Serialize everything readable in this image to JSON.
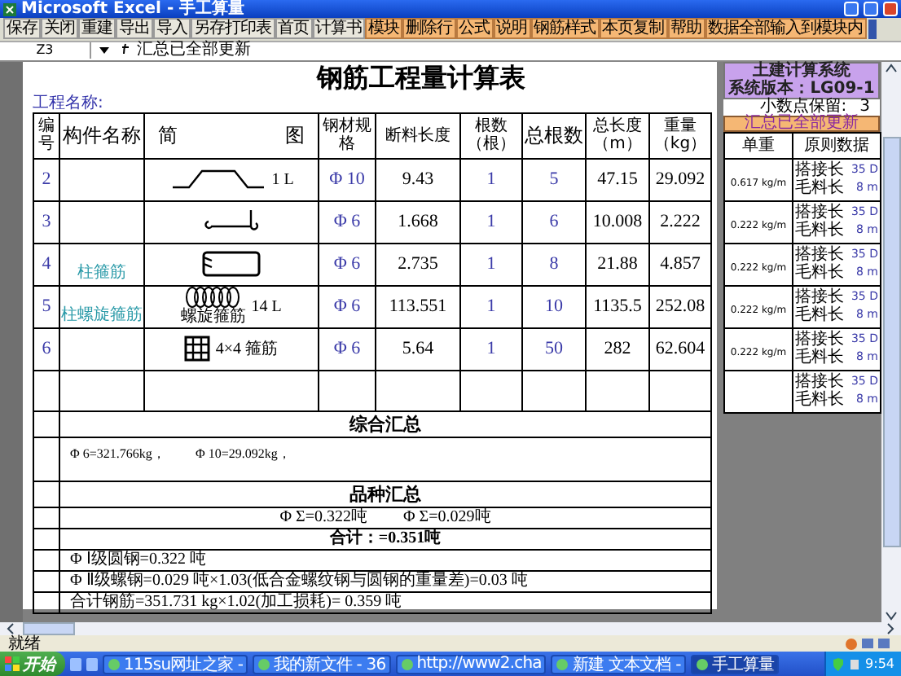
{
  "window": {
    "title": "Microsoft Excel - 手工算量"
  },
  "toolbar": [
    {
      "label": "保存",
      "kind": "plain"
    },
    {
      "label": "关闭",
      "kind": "plain"
    },
    {
      "label": "重建",
      "kind": "plain"
    },
    {
      "label": "导出",
      "kind": "plain"
    },
    {
      "label": "导入",
      "kind": "plain"
    },
    {
      "label": "另存打印表",
      "kind": "plain"
    },
    {
      "label": "首页",
      "kind": "plain"
    },
    {
      "label": "计算书",
      "kind": "plain"
    },
    {
      "label": "模块",
      "kind": "accent"
    },
    {
      "label": "删除行",
      "kind": "accent"
    },
    {
      "label": "公式",
      "kind": "accent"
    },
    {
      "label": "说明",
      "kind": "accent"
    },
    {
      "label": "钢筋样式",
      "kind": "accent"
    },
    {
      "label": "本页复制",
      "kind": "accent"
    },
    {
      "label": "帮助",
      "kind": "accent"
    },
    {
      "label": "数据全部输入到模块内",
      "kind": "accent"
    }
  ],
  "formula_bar": {
    "cell": "Z3",
    "content": "汇总已全部更新"
  },
  "sheet": {
    "title": "钢筋工程量计算表",
    "project_label": "工程名称:",
    "columns": [
      "编号",
      "构件名称",
      "简",
      "图",
      "钢材规格",
      "断料长度",
      "根数（根）",
      "总根数",
      "总长度（m）",
      "重量（kg）"
    ],
    "rows": [
      {
        "no": "2",
        "name": "",
        "kind": "bent",
        "shape_note": "1 L",
        "spec": "Φ 10",
        "cut_length": "9.43",
        "count": "1",
        "total_count": "5",
        "total_length": "47.15",
        "weight": "29.092"
      },
      {
        "no": "3",
        "name": "",
        "kind": "hook",
        "shape_note": "",
        "spec": "Φ 6",
        "cut_length": "1.668",
        "count": "1",
        "total_count": "6",
        "total_length": "10.008",
        "weight": "2.222"
      },
      {
        "no": "4",
        "name": "柱箍筋",
        "kind": "stirrup",
        "shape_note": "",
        "spec": "Φ 6",
        "cut_length": "2.735",
        "count": "1",
        "total_count": "8",
        "total_length": "21.88",
        "weight": "4.857"
      },
      {
        "no": "5",
        "name": "柱螺旋箍筋",
        "kind": "spiral",
        "shape_caption": "螺旋箍筋",
        "shape_note": "14 L",
        "spec": "Φ 6",
        "cut_length": "113.551",
        "count": "1",
        "total_count": "10",
        "total_length": "1135.5",
        "weight": "252.08"
      },
      {
        "no": "6",
        "name": "",
        "kind": "grid",
        "shape_note": "4×4 箍筋",
        "spec": "Φ 6",
        "cut_length": "5.64",
        "count": "1",
        "total_count": "50",
        "total_length": "282",
        "weight": "62.604"
      }
    ],
    "summary": {
      "title": "综合汇总",
      "items": [
        "Φ 6=321.766kg，",
        "Φ 10=29.092kg，"
      ]
    },
    "variety": {
      "title": "品种汇总",
      "items": [
        "Φ Σ=0.322吨",
        "Φ Σ=0.029吨"
      ]
    },
    "total": "合计：=0.351吨",
    "notes": [
      "Φ Ⅰ级圆钢=0.322 吨",
      "Φ Ⅱ级螺钢=0.029 吨×1.03(低合金螺纹钢与圆钢的重量差)=0.03 吨",
      "合计钢筋=351.731 kg×1.02(加工损耗)= 0.359 吨"
    ]
  },
  "side_panel": {
    "title": "土建计算系统",
    "version": "系统版本：LG09-1",
    "decimals_label": "小数点保留:",
    "decimals": "3",
    "update_button": "汇总已全部更新",
    "columns": [
      "单重",
      "原则数据"
    ],
    "rows": [
      {
        "unit_weight": "0.617 kg/m",
        "lap_label": "搭接长",
        "lap": "35 D",
        "stock_label": "毛料长",
        "stock": "8 m"
      },
      {
        "unit_weight": "0.222 kg/m",
        "lap_label": "搭接长",
        "lap": "35 D",
        "stock_label": "毛料长",
        "stock": "8 m"
      },
      {
        "unit_weight": "0.222 kg/m",
        "lap_label": "搭接长",
        "lap": "35 D",
        "stock_label": "毛料长",
        "stock": "8 m"
      },
      {
        "unit_weight": "0.222 kg/m",
        "lap_label": "搭接长",
        "lap": "35 D",
        "stock_label": "毛料长",
        "stock": "8 m"
      },
      {
        "unit_weight": "0.222 kg/m",
        "lap_label": "搭接长",
        "lap": "35 D",
        "stock_label": "毛料长",
        "stock": "8 m"
      },
      {
        "unit_weight": "",
        "lap_label": "搭接长",
        "lap": "35 D",
        "stock_label": "毛料长",
        "stock": "8 m"
      }
    ]
  },
  "status_bar": {
    "text": "就绪"
  },
  "taskbar": {
    "start": "开始",
    "tasks": [
      {
        "label": "115su网址之家 -",
        "selected": false
      },
      {
        "label": "我的新文件 - 36",
        "selected": false
      },
      {
        "label": "http://www2.cha",
        "selected": false
      },
      {
        "label": "新建 文本文档 -",
        "selected": false
      },
      {
        "label": "手工算量",
        "selected": true
      }
    ],
    "time": "9:54"
  }
}
